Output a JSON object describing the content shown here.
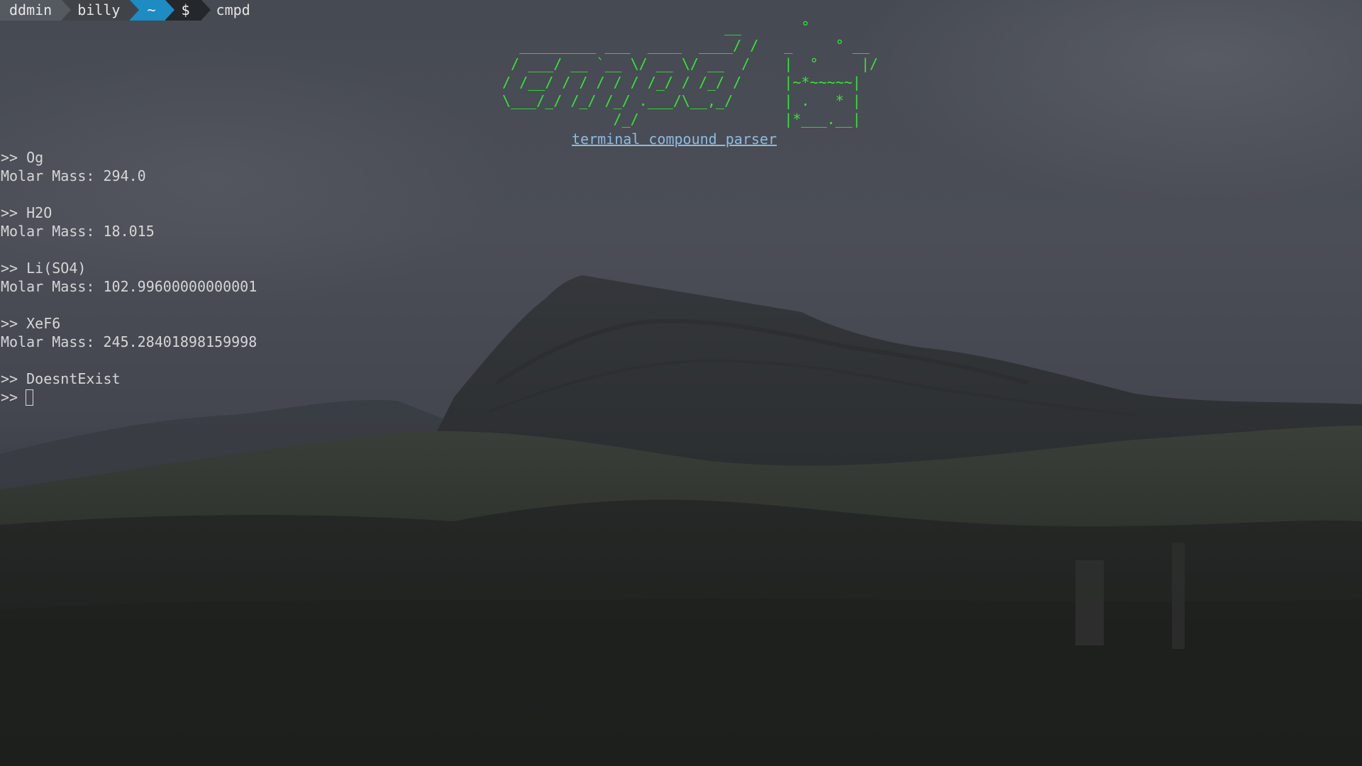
{
  "prompt": {
    "user": "ddmin",
    "host": "billy",
    "cwd": "~",
    "symbol": "$",
    "command": "cmpd"
  },
  "banner": {
    "ascii_art": "                          __       °\n  _________ ___  ____  ____/ /   _     ° __\n / ___/ __ `__ \\/ __ \\/ __  /    |  °     |/\n/ /__/ / / / / / /_/ / /_/ /     |~*~~~~~|\n\\___/_/ /_/ /_/ .___/\\__,_/      | .   * |\n             /_/                 |*___.__|",
    "tagline": "terminal compound parser"
  },
  "session": {
    "prompt_marker": ">>",
    "entries": [
      {
        "input": "Og",
        "output": "Molar Mass: 294.0"
      },
      {
        "input": "H2O",
        "output": "Molar Mass: 18.015"
      },
      {
        "input": "Li(SO4)",
        "output": "Molar Mass: 102.99600000000001"
      },
      {
        "input": "XeF6",
        "output": "Molar Mass: 245.28401898159998"
      }
    ],
    "last_input": "DoesntExist",
    "current_input": ""
  },
  "colors": {
    "banner_green": "#33e833",
    "tagline_blue": "#8dbbe0",
    "dir_segment_blue": "#1d8cc2",
    "text": "#d6d6d6"
  },
  "icons": {
    "cursor": "block-cursor-icon",
    "segment_separator": "powerline-arrow-icon"
  }
}
